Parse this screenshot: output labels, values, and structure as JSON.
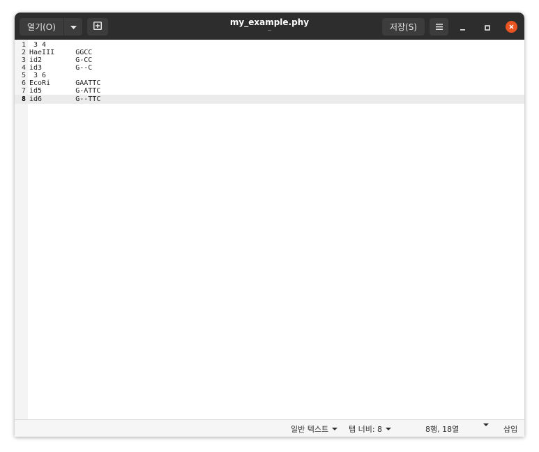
{
  "titlebar": {
    "open_label": "열기(O)",
    "title": "my_example.phy",
    "subtitle": "~",
    "save_label": "저장(S)"
  },
  "editor": {
    "lines": [
      {
        "num": "1",
        "text": " 3 4"
      },
      {
        "num": "2",
        "text": "HaeIII     GGCC"
      },
      {
        "num": "3",
        "text": "id2        G-CC"
      },
      {
        "num": "4",
        "text": "id3        G--C"
      },
      {
        "num": "5",
        "text": " 3 6"
      },
      {
        "num": "6",
        "text": "EcoRi      GAATTC"
      },
      {
        "num": "7",
        "text": "id5        G-ATTC"
      },
      {
        "num": "8",
        "text": "id6        G--TTC"
      }
    ],
    "current_line": 8
  },
  "statusbar": {
    "language": "일반 텍스트",
    "tab_width": "탭 너비: 8",
    "position": "8행, 18열",
    "insert_mode": "삽입"
  },
  "colors": {
    "titlebar_bg": "#2d2d2d",
    "close_button": "#e95420",
    "current_line_bg": "#ebebeb"
  }
}
